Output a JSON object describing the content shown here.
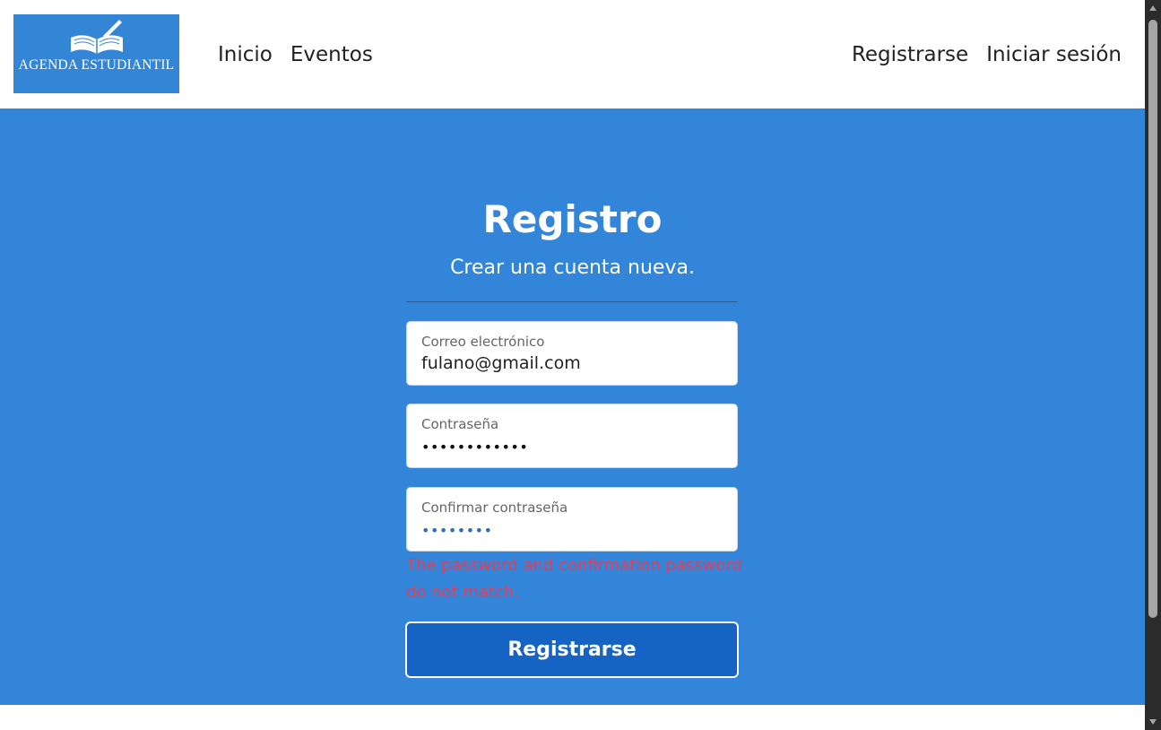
{
  "nav": {
    "logo_text": "AGENDA ESTUDIANTIL",
    "left_links": [
      "Inicio",
      "Eventos"
    ],
    "right_links": [
      "Registrarse",
      "Iniciar sesión"
    ]
  },
  "form": {
    "title": "Registro",
    "subtitle": "Crear una cuenta nueva.",
    "email": {
      "label": "Correo electrónico",
      "value": "fulano@gmail.com"
    },
    "password": {
      "label": "Contraseña",
      "masked_value": "••••••••••••"
    },
    "confirm_password": {
      "label": "Confirmar contraseña",
      "masked_value": "••••••••"
    },
    "error_message": "The password and confirmation password do not match.",
    "submit_label": "Registrarse"
  },
  "colors": {
    "brand_blue": "#3385d9",
    "button_blue": "#1563c3",
    "error_red": "#e0405a"
  }
}
